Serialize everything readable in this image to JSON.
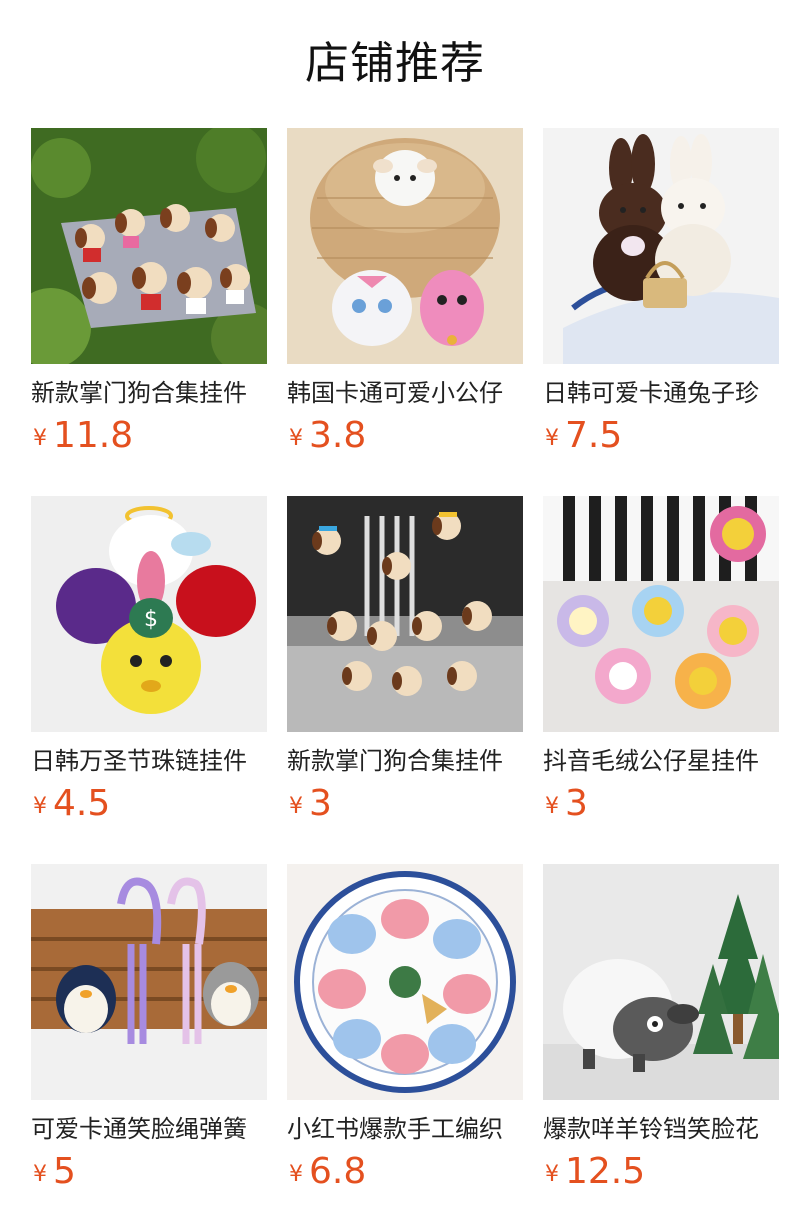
{
  "header": {
    "title": "店铺推荐"
  },
  "products": [
    {
      "name": "新款掌门狗合集挂件",
      "currency": "¥",
      "price": "11.8",
      "theme": "dogs-grass"
    },
    {
      "name": "韩国卡通可爱小公仔",
      "currency": "¥",
      "price": "3.8",
      "theme": "cats-straw"
    },
    {
      "name": "日韩可爱卡通兔子珍",
      "currency": "¥",
      "price": "7.5",
      "theme": "bunnies"
    },
    {
      "name": "日韩万圣节珠链挂件",
      "currency": "¥",
      "price": "4.5",
      "theme": "halloween"
    },
    {
      "name": "新款掌门狗合集挂件",
      "currency": "¥",
      "price": "3",
      "theme": "dogs-bag"
    },
    {
      "name": "抖音毛绒公仔星挂件",
      "currency": "¥",
      "price": "3",
      "theme": "flowers"
    },
    {
      "name": "可爱卡通笑脸绳弹簧",
      "currency": "¥",
      "price": "5",
      "theme": "penguins-basket"
    },
    {
      "name": "小红书爆款手工编织",
      "currency": "¥",
      "price": "6.8",
      "theme": "whales-plate"
    },
    {
      "name": "爆款咩羊铃铛笑脸花",
      "currency": "¥",
      "price": "12.5",
      "theme": "sheep-trees"
    }
  ]
}
